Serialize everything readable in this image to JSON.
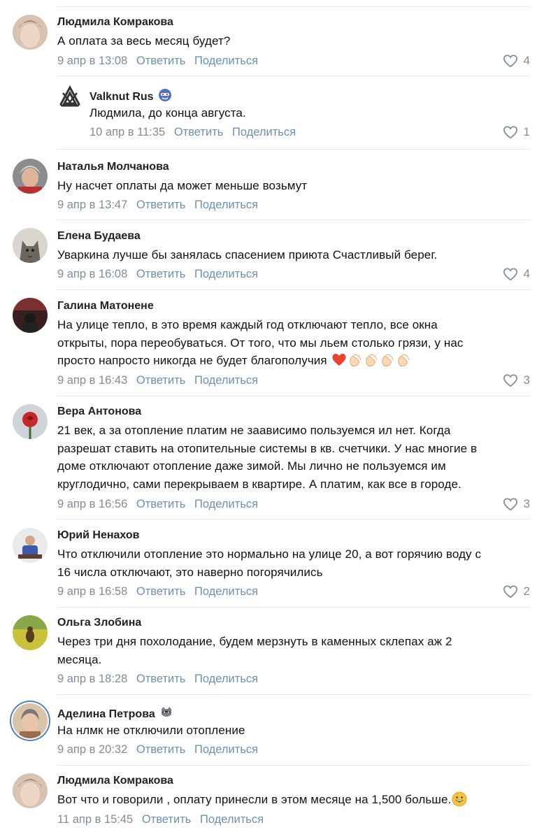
{
  "actions": {
    "reply": "Ответить",
    "share": "Поделиться"
  },
  "comments": [
    {
      "author": "Людмила Комракова",
      "text": "А оплата за весь месяц будет?",
      "date": "9 апр в 13:08",
      "likes": "4"
    },
    {
      "author": "Valknut Rus",
      "text": "Людмила, до конца августа.",
      "date": "10 апр в 11:35",
      "likes": "1"
    },
    {
      "author": "Наталья Молчанова",
      "text": "Ну насчет оплаты да может меньше возьмут",
      "date": "9 апр в 13:47",
      "likes": ""
    },
    {
      "author": "Елена Будаева",
      "text": "Уваркина лучше бы занялась спасением приюта Счастливый берег.",
      "date": "9 апр в 16:08",
      "likes": "4"
    },
    {
      "author": "Галина Матонене",
      "text_lines": [
        "На улице тепло, в это время каждый год отключают тепло, все окна",
        "открыты, пора переобуваться. От того, что мы льем столько грязи, у нас",
        "просто напросто никогда не будет благополучия"
      ],
      "date": "9 апр в 16:43",
      "likes": "3"
    },
    {
      "author": "Вера Антонова",
      "text_lines": [
        "21 век, а за отопление платим не заависимо пользуемся ил нет. Когда",
        "разрешат ставить на отопительные системы в кв. счетчики. У нас многие в",
        "доме отключают отопление даже зимой. Мы лично не пользуемся им",
        "круглодично, сами перекрываем в квартире. А платим, как все в городе."
      ],
      "date": "9 апр в 16:56",
      "likes": "3"
    },
    {
      "author": "Юрий Ненахов",
      "text_lines": [
        "Что отключили отопление это нормально на улице 20, а вот горячию воду с",
        "16 числа отключают, это наверно погорячились"
      ],
      "date": "9 апр в 16:58",
      "likes": "2"
    },
    {
      "author": "Ольга Злобина",
      "text_lines": [
        "Через три дня похолодание, будем мерзнуть в каменных склепах аж 2",
        "месяца."
      ],
      "date": "9 апр в 18:28",
      "likes": ""
    },
    {
      "author": "Аделина Петрова",
      "text": "На нлмк не отключили отопление",
      "date": "9 апр в 20:32",
      "likes": ""
    },
    {
      "author": "Людмила Комракова",
      "text": "Вот что и говорили , оплату принесли в этом месяце на 1,500 больше.",
      "date": "11 апр в 15:45",
      "likes": ""
    }
  ]
}
